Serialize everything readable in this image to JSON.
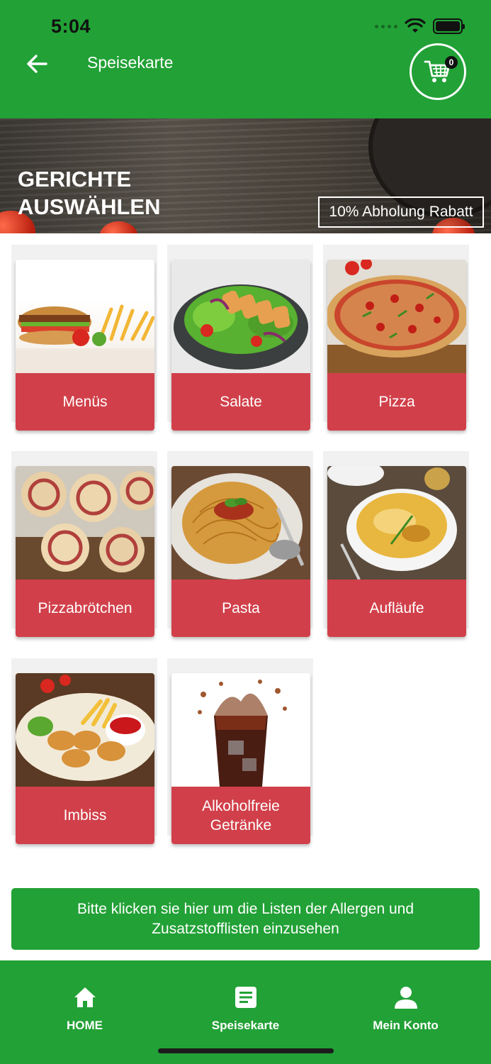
{
  "status_bar": {
    "time": "5:04"
  },
  "header": {
    "title": "Speisekarte",
    "back_icon": "arrow-left-icon",
    "cart_icon": "shopping-cart-icon",
    "cart_count": "0"
  },
  "banner": {
    "title": "GERICHTE AUSWÄHLEN",
    "badge": "10% Abholung Rabatt"
  },
  "categories": [
    {
      "label": "Menüs",
      "image": "burger-fries-photo"
    },
    {
      "label": "Salate",
      "image": "chicken-salad-photo"
    },
    {
      "label": "Pizza",
      "image": "pizza-photo"
    },
    {
      "label": "Pizzabrötchen",
      "image": "pizza-rolls-photo"
    },
    {
      "label": "Pasta",
      "image": "spaghetti-photo"
    },
    {
      "label": "Aufläufe",
      "image": "gratin-photo"
    },
    {
      "label": "Imbiss",
      "image": "nuggets-fries-photo"
    },
    {
      "label": "Alkoholfreie Getränke",
      "image": "cola-glass-photo"
    }
  ],
  "allergen_button": {
    "label": "Bitte klicken sie hier um die Listen der Allergen und Zusatzstofflisten einzusehen"
  },
  "bottom_nav": [
    {
      "label": "HOME",
      "icon": "home-icon"
    },
    {
      "label": "Speisekarte",
      "icon": "menu-list-icon"
    },
    {
      "label": "Mein Konto",
      "icon": "user-icon"
    }
  ],
  "colors": {
    "primary_green": "#22a136",
    "category_red": "#d1404a"
  }
}
